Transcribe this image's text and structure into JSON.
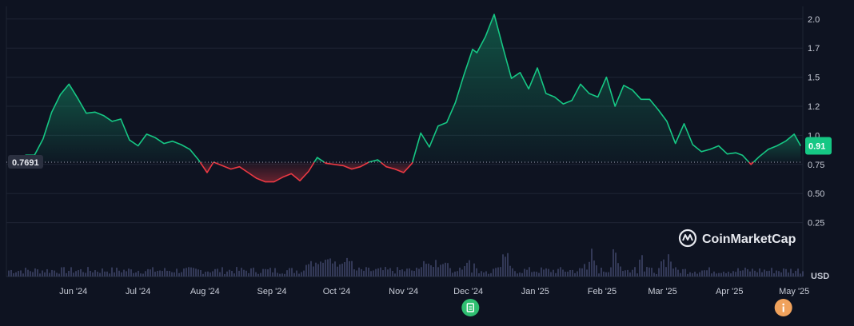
{
  "watermark": "CoinMarketCap",
  "currency_label": "USD",
  "chart_data": {
    "type": "area",
    "yticks": [
      "0.25",
      "0.50",
      "0.75",
      "1.0",
      "1.2",
      "1.5",
      "1.7",
      "2.0"
    ],
    "ytick_values": [
      0.25,
      0.5,
      0.75,
      1.0,
      1.25,
      1.5,
      1.75,
      2.0
    ],
    "ylim": [
      0,
      2.25
    ],
    "baseline": {
      "value": 0.7691,
      "label": "0.7691"
    },
    "current": {
      "value": 0.91,
      "label": "0.91"
    },
    "xticks": [
      "Jun '24",
      "Jul '24",
      "Aug '24",
      "Sep '24",
      "Oct '24",
      "Nov '24",
      "Dec '24",
      "Jan '25",
      "Feb '25",
      "Mar '25",
      "Apr '25",
      "May '25"
    ],
    "xtick_dates": [
      "2024-06-01",
      "2024-07-01",
      "2024-08-01",
      "2024-09-01",
      "2024-10-01",
      "2024-11-01",
      "2024-12-01",
      "2025-01-01",
      "2025-02-01",
      "2025-03-01",
      "2025-04-01",
      "2025-05-01"
    ],
    "x": [
      "2024-05-06",
      "2024-05-10",
      "2024-05-14",
      "2024-05-18",
      "2024-05-22",
      "2024-05-26",
      "2024-05-30",
      "2024-06-03",
      "2024-06-07",
      "2024-06-11",
      "2024-06-15",
      "2024-06-19",
      "2024-06-23",
      "2024-06-27",
      "2024-07-01",
      "2024-07-05",
      "2024-07-09",
      "2024-07-13",
      "2024-07-17",
      "2024-07-21",
      "2024-07-25",
      "2024-07-29",
      "2024-08-02",
      "2024-08-05",
      "2024-08-09",
      "2024-08-13",
      "2024-08-17",
      "2024-08-21",
      "2024-08-25",
      "2024-08-29",
      "2024-09-02",
      "2024-09-06",
      "2024-09-10",
      "2024-09-14",
      "2024-09-18",
      "2024-09-22",
      "2024-09-26",
      "2024-09-30",
      "2024-10-04",
      "2024-10-08",
      "2024-10-12",
      "2024-10-16",
      "2024-10-20",
      "2024-10-24",
      "2024-10-28",
      "2024-11-01",
      "2024-11-05",
      "2024-11-09",
      "2024-11-13",
      "2024-11-17",
      "2024-11-21",
      "2024-11-25",
      "2024-11-29",
      "2024-12-03",
      "2024-12-05",
      "2024-12-09",
      "2024-12-13",
      "2024-12-17",
      "2024-12-21",
      "2024-12-25",
      "2024-12-29",
      "2025-01-02",
      "2025-01-06",
      "2025-01-10",
      "2025-01-14",
      "2025-01-18",
      "2025-01-22",
      "2025-01-26",
      "2025-01-30",
      "2025-02-03",
      "2025-02-07",
      "2025-02-11",
      "2025-02-15",
      "2025-02-19",
      "2025-02-23",
      "2025-02-27",
      "2025-03-03",
      "2025-03-07",
      "2025-03-11",
      "2025-03-15",
      "2025-03-19",
      "2025-03-23",
      "2025-03-27",
      "2025-03-31",
      "2025-04-04",
      "2025-04-07",
      "2025-04-11",
      "2025-04-15",
      "2025-04-19",
      "2025-04-23",
      "2025-04-27",
      "2025-05-01",
      "2025-05-04"
    ],
    "values": [
      0.79,
      0.83,
      0.83,
      0.97,
      1.2,
      1.35,
      1.44,
      1.32,
      1.19,
      1.2,
      1.17,
      1.12,
      1.14,
      0.96,
      0.91,
      1.01,
      0.98,
      0.93,
      0.95,
      0.92,
      0.88,
      0.79,
      0.68,
      0.77,
      0.74,
      0.71,
      0.73,
      0.68,
      0.63,
      0.6,
      0.6,
      0.64,
      0.67,
      0.61,
      0.69,
      0.81,
      0.76,
      0.75,
      0.74,
      0.71,
      0.73,
      0.77,
      0.79,
      0.73,
      0.71,
      0.68,
      0.76,
      1.02,
      0.9,
      1.08,
      1.11,
      1.28,
      1.52,
      1.74,
      1.71,
      1.85,
      2.04,
      1.76,
      1.49,
      1.54,
      1.4,
      1.58,
      1.36,
      1.33,
      1.27,
      1.3,
      1.44,
      1.36,
      1.33,
      1.5,
      1.25,
      1.43,
      1.39,
      1.31,
      1.31,
      1.22,
      1.12,
      0.93,
      1.1,
      0.92,
      0.86,
      0.88,
      0.91,
      0.84,
      0.85,
      0.83,
      0.75,
      0.82,
      0.88,
      0.91,
      0.95,
      1.01,
      0.91
    ],
    "volume_spikes": [
      "2024-12-01",
      "2024-12-17",
      "2025-01-26",
      "2025-02-07",
      "2025-02-19",
      "2025-03-03"
    ],
    "grid": true,
    "events": [
      {
        "date": "2024-12-02",
        "icon": "document-icon",
        "color": "#2fbf71"
      },
      {
        "date": "2025-04-26",
        "icon": "info-icon",
        "color": "#f0a25c"
      }
    ]
  }
}
